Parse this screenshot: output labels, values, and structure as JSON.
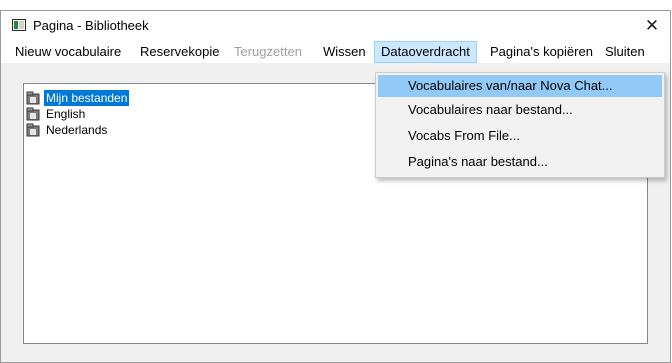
{
  "window": {
    "title": "Pagina - Bibliotheek",
    "close_symbol": "✕"
  },
  "menubar": {
    "items": [
      {
        "label": "Nieuw vocabulaire",
        "enabled": true
      },
      {
        "label": "Reservekopie",
        "enabled": true
      },
      {
        "label": "Terugzetten",
        "enabled": false
      },
      {
        "label": "Wissen",
        "enabled": true
      },
      {
        "label": "Dataoverdracht",
        "enabled": true,
        "active": true
      },
      {
        "label": "Pagina's kopiëren",
        "enabled": true
      },
      {
        "label": "Sluiten",
        "enabled": true
      }
    ]
  },
  "dropdown": {
    "items": [
      {
        "label": "Vocabulaires van/naar Nova Chat...",
        "highlighted": true
      },
      {
        "label": "Vocabulaires naar bestand..."
      },
      {
        "label": "Vocabs From File..."
      },
      {
        "label": "Pagina's naar bestand..."
      }
    ]
  },
  "tree": {
    "items": [
      {
        "label": "Mijn bestanden",
        "selected": true,
        "icon": "folder-icon"
      },
      {
        "label": "English",
        "icon": "folder-icon"
      },
      {
        "label": "Nederlands",
        "icon": "folder-icon"
      }
    ]
  },
  "colors": {
    "selection": "#0078d7",
    "menu_active": "#cce8ff",
    "dropdown_highlight": "#91c9f7"
  }
}
